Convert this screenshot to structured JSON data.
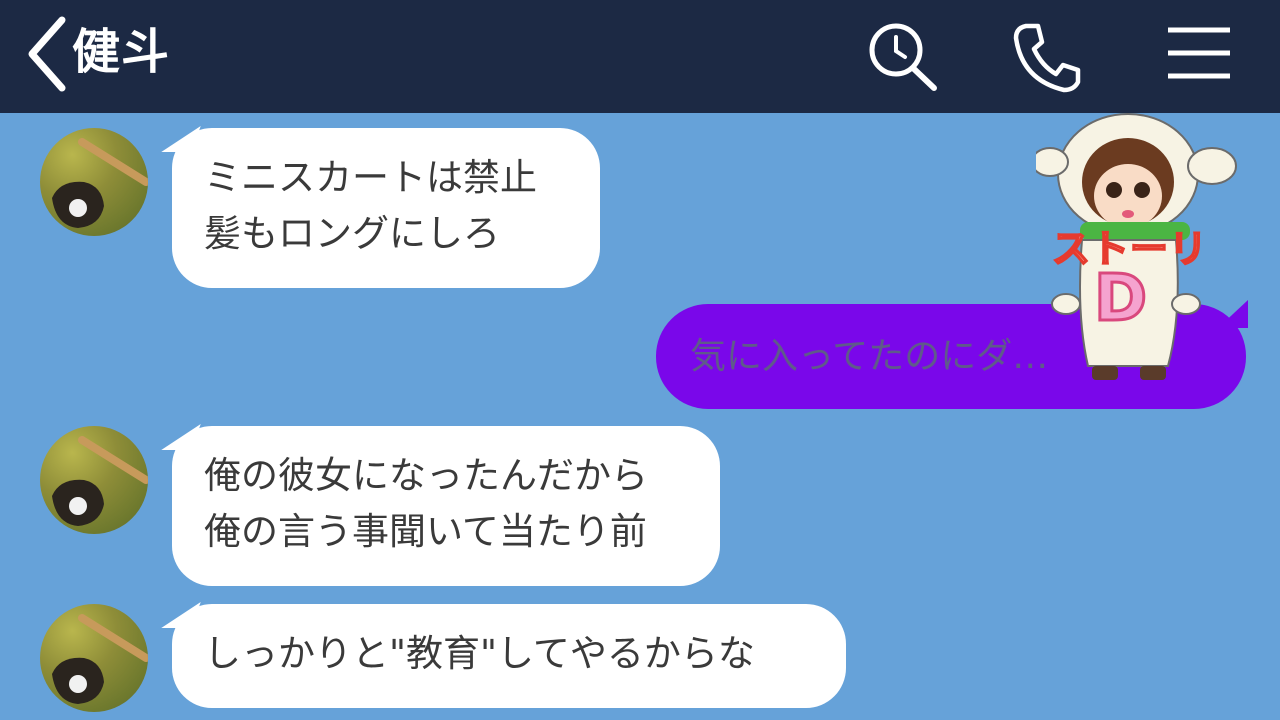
{
  "header": {
    "title": "健斗",
    "background": "#1c2944",
    "icons": [
      "back-chevron-icon",
      "search-icon",
      "call-icon",
      "menu-icon"
    ]
  },
  "chat_background": "#66a2d9",
  "messages": [
    {
      "from": "健斗",
      "lines": [
        "ミニスカートは禁止",
        "髪もロングにしろ"
      ]
    },
    {
      "from": "me",
      "text": "気に入ってたのにダ…",
      "bubble_color": "#7a07ea"
    },
    {
      "from": "健斗",
      "lines": [
        "俺の彼女になったんだから",
        "俺の言う事聞いて当たり前"
      ]
    },
    {
      "from": "健斗",
      "lines": [
        "しっかりと\"教育\"してやるからな"
      ]
    }
  ],
  "overlay": {
    "word": "ストーリ",
    "letter": "D"
  }
}
